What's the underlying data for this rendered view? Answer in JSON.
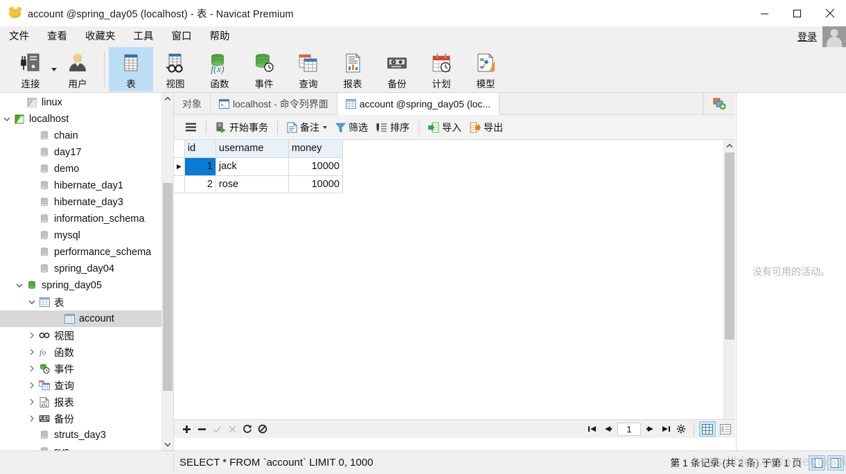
{
  "window": {
    "title": "account @spring_day05 (localhost) - 表 - Navicat Premium",
    "app_icon": "navicat-logo-icon",
    "minimize_label": "minimize",
    "maximize_label": "maximize",
    "close_label": "close"
  },
  "menubar": {
    "items": [
      {
        "label": "文件",
        "name": "menu-file"
      },
      {
        "label": "查看",
        "name": "menu-view"
      },
      {
        "label": "收藏夹",
        "name": "menu-favorites"
      },
      {
        "label": "工具",
        "name": "menu-tools"
      },
      {
        "label": "窗口",
        "name": "menu-window"
      },
      {
        "label": "帮助",
        "name": "menu-help"
      }
    ],
    "login_label": "登录",
    "avatar": "user-avatar-icon"
  },
  "ribbon": {
    "items": [
      {
        "label": "连接",
        "icon": "connection-icon",
        "active": false,
        "has_dropdown": true
      },
      {
        "label": "用户",
        "icon": "user-icon",
        "active": false,
        "has_dropdown": false
      },
      {
        "label": "表",
        "icon": "table-icon",
        "active": true,
        "has_dropdown": false
      },
      {
        "label": "视图",
        "icon": "view-icon",
        "active": false,
        "has_dropdown": false
      },
      {
        "label": "函数",
        "icon": "function-icon",
        "active": false,
        "has_dropdown": false
      },
      {
        "label": "事件",
        "icon": "event-icon",
        "active": false,
        "has_dropdown": false
      },
      {
        "label": "查询",
        "icon": "query-icon",
        "active": false,
        "has_dropdown": false
      },
      {
        "label": "报表",
        "icon": "report-icon",
        "active": false,
        "has_dropdown": false
      },
      {
        "label": "备份",
        "icon": "backup-icon",
        "active": false,
        "has_dropdown": false
      },
      {
        "label": "计划",
        "icon": "schedule-icon",
        "active": false,
        "has_dropdown": false
      },
      {
        "label": "模型",
        "icon": "model-icon",
        "active": false,
        "has_dropdown": false
      }
    ]
  },
  "sidebar": {
    "nodes": [
      {
        "label": "linux",
        "icon": "connection-gray-icon",
        "indent": 1,
        "arrow": "none",
        "selected": false
      },
      {
        "label": "localhost",
        "icon": "connection-green-icon",
        "indent": 0,
        "arrow": "expanded",
        "selected": false
      },
      {
        "label": "chain",
        "icon": "database-gray-icon",
        "indent": 2,
        "arrow": "none",
        "selected": false
      },
      {
        "label": "day17",
        "icon": "database-gray-icon",
        "indent": 2,
        "arrow": "none",
        "selected": false
      },
      {
        "label": "demo",
        "icon": "database-gray-icon",
        "indent": 2,
        "arrow": "none",
        "selected": false
      },
      {
        "label": "hibernate_day1",
        "icon": "database-gray-icon",
        "indent": 2,
        "arrow": "none",
        "selected": false
      },
      {
        "label": "hibernate_day3",
        "icon": "database-gray-icon",
        "indent": 2,
        "arrow": "none",
        "selected": false
      },
      {
        "label": "information_schema",
        "icon": "database-gray-icon",
        "indent": 2,
        "arrow": "none",
        "selected": false
      },
      {
        "label": "mysql",
        "icon": "database-gray-icon",
        "indent": 2,
        "arrow": "none",
        "selected": false
      },
      {
        "label": "performance_schema",
        "icon": "database-gray-icon",
        "indent": 2,
        "arrow": "none",
        "selected": false
      },
      {
        "label": "spring_day04",
        "icon": "database-gray-icon",
        "indent": 2,
        "arrow": "none",
        "selected": false
      },
      {
        "label": "spring_day05",
        "icon": "database-green-icon",
        "indent": 1,
        "arrow": "expanded",
        "selected": false
      },
      {
        "label": "表",
        "icon": "table-folder-icon",
        "indent": 2,
        "arrow": "expanded",
        "selected": false
      },
      {
        "label": "account",
        "icon": "table-item-icon",
        "indent": 4,
        "arrow": "none",
        "selected": true
      },
      {
        "label": "视图",
        "icon": "view-folder-icon",
        "indent": 2,
        "arrow": "collapsed",
        "selected": false
      },
      {
        "label": "函数",
        "icon": "function-folder-icon",
        "indent": 2,
        "arrow": "collapsed",
        "selected": false
      },
      {
        "label": "事件",
        "icon": "event-folder-icon",
        "indent": 2,
        "arrow": "collapsed",
        "selected": false
      },
      {
        "label": "查询",
        "icon": "query-folder-icon",
        "indent": 2,
        "arrow": "collapsed",
        "selected": false
      },
      {
        "label": "报表",
        "icon": "report-folder-icon",
        "indent": 2,
        "arrow": "collapsed",
        "selected": false
      },
      {
        "label": "备份",
        "icon": "backup-folder-icon",
        "indent": 2,
        "arrow": "collapsed",
        "selected": false
      },
      {
        "label": "struts_day3",
        "icon": "database-gray-icon",
        "indent": 2,
        "arrow": "none",
        "selected": false
      },
      {
        "label": "sys",
        "icon": "database-gray-icon",
        "indent": 2,
        "arrow": "none",
        "selected": false
      }
    ]
  },
  "tabs": [
    {
      "label": "对象",
      "icon": "none",
      "active": false
    },
    {
      "label": "localhost - 命令列界面",
      "icon": "console-icon",
      "active": false
    },
    {
      "label": "account @spring_day05 (loc...",
      "icon": "table-item-icon",
      "active": true
    }
  ],
  "tab_add_label": "new-tab",
  "grid_toolbar": {
    "menu_icon": "hamburger-icon",
    "buttons": [
      {
        "label": "开始事务",
        "icon": "begin-transaction-icon",
        "caret": false
      },
      {
        "label": "备注",
        "icon": "note-icon",
        "caret": true
      },
      {
        "label": "筛选",
        "icon": "filter-icon",
        "caret": false
      },
      {
        "label": "排序",
        "icon": "sort-icon",
        "caret": false
      },
      {
        "label": "导入",
        "icon": "import-icon",
        "caret": false
      },
      {
        "label": "导出",
        "icon": "export-icon",
        "caret": false
      }
    ]
  },
  "table": {
    "columns": [
      "id",
      "username",
      "money"
    ],
    "rows": [
      {
        "id": "1",
        "username": "jack",
        "money": "10000",
        "current": true
      },
      {
        "id": "2",
        "username": "rose",
        "money": "10000",
        "current": false
      }
    ]
  },
  "grid_footer": {
    "edit_buttons": [
      {
        "name": "add-record-button",
        "glyph": "+",
        "enabled": true
      },
      {
        "name": "delete-record-button",
        "glyph": "−",
        "enabled": true
      },
      {
        "name": "apply-change-button",
        "glyph": "✓",
        "enabled": false
      },
      {
        "name": "cancel-change-button",
        "glyph": "✕",
        "enabled": false
      },
      {
        "name": "refresh-button",
        "glyph": "⟳",
        "enabled": true
      },
      {
        "name": "stop-button",
        "glyph": "⊘",
        "enabled": true
      }
    ],
    "nav": {
      "first": "first-page-button",
      "prev": "prev-page-button",
      "page_value": "1",
      "next": "next-page-button",
      "last": "last-page-button",
      "settings": "page-settings-button"
    },
    "view_modes": [
      {
        "name": "grid-view-button",
        "active": true
      },
      {
        "name": "form-view-button",
        "active": false
      }
    ]
  },
  "right_panel": {
    "empty_text": "没有可用的活动。"
  },
  "statusbar": {
    "sql": "SELECT * FROM `account` LIMIT 0, 1000",
    "record_info": "第 1 条记录 (共 2 条) 于第 1 页",
    "toggles": [
      {
        "name": "toggle-info-pane-button",
        "active": true
      },
      {
        "name": "toggle-right-pane-button",
        "active": true
      }
    ]
  },
  "watermark": "https://blog.csdn.net/qq_43414199",
  "colors": {
    "accent_selection": "#0a7ad4",
    "ribbon_active": "#bdddf4",
    "header_bg": "#e8f0f8",
    "chrome_bg": "#f0f0f0",
    "tree_selected": "#d8d8d8"
  }
}
